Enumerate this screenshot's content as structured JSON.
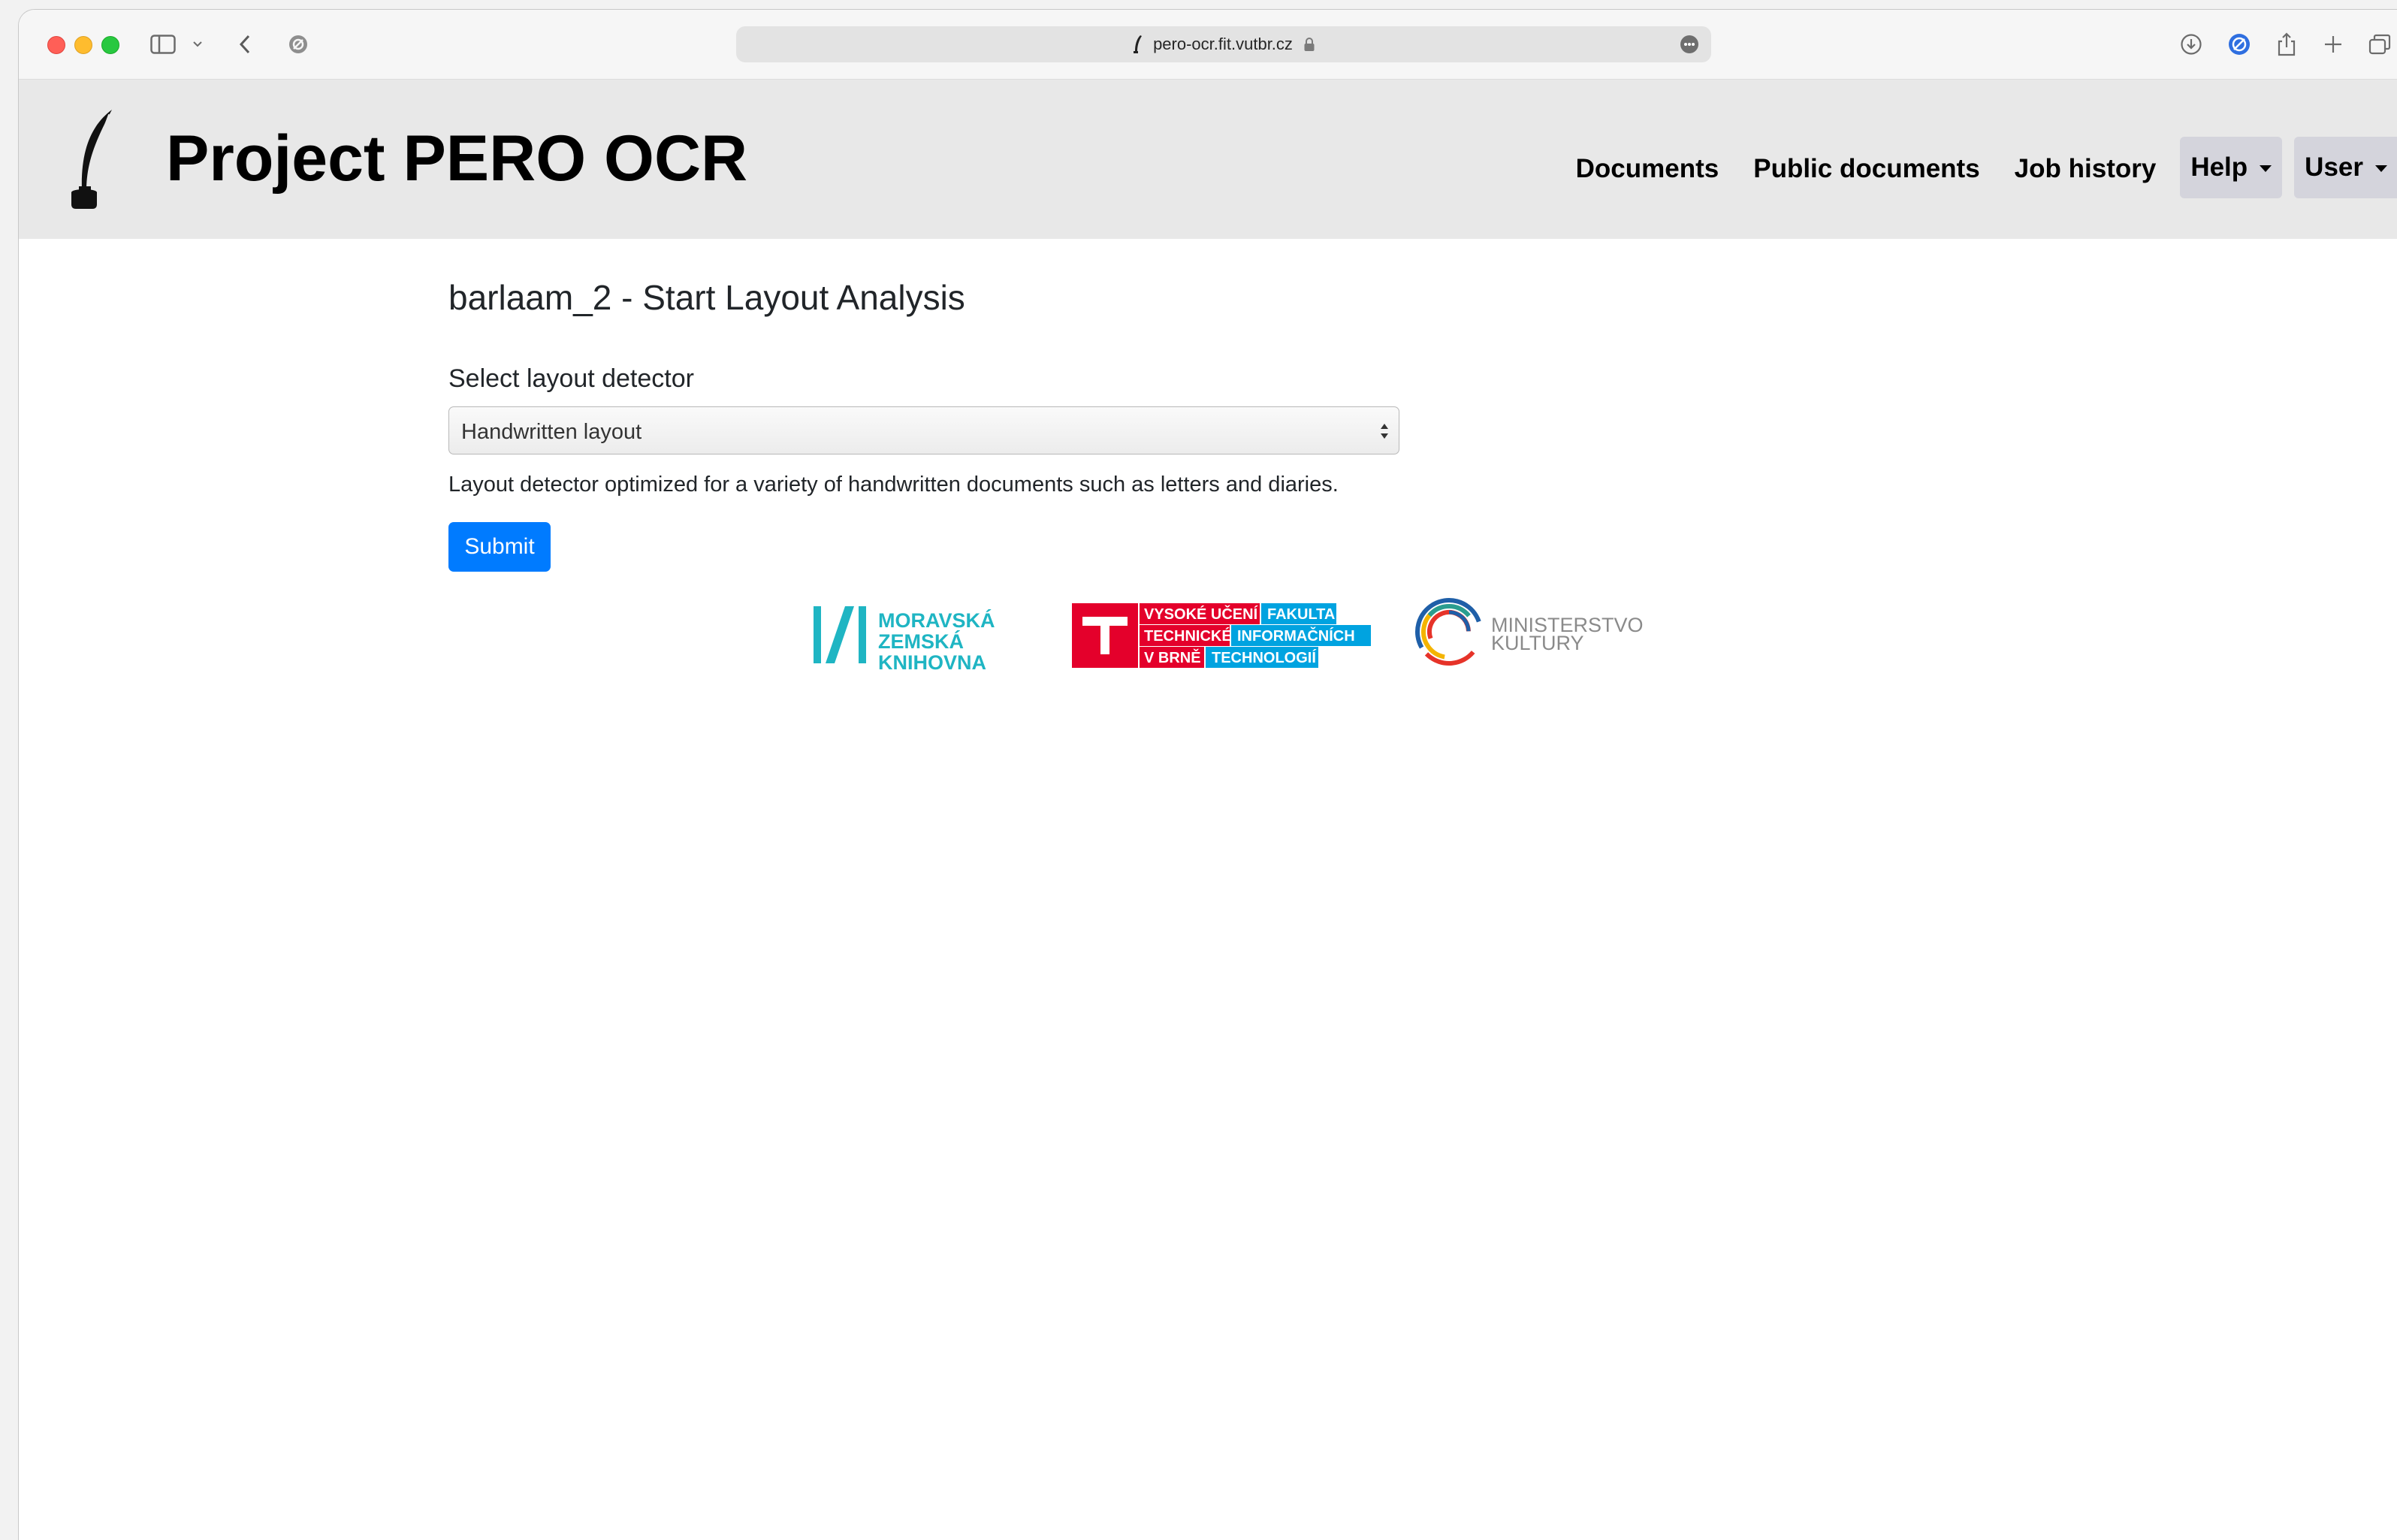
{
  "browser": {
    "url": "pero-ocr.fit.vutbr.cz"
  },
  "header": {
    "title": "Project PERO OCR",
    "nav": {
      "documents": "Documents",
      "public_documents": "Public documents",
      "job_history": "Job history",
      "help": "Help",
      "user": "User"
    }
  },
  "main": {
    "page_title": "barlaam_2 - Start Layout Analysis",
    "field_label": "Select layout detector",
    "select_value": "Handwritten layout",
    "help_text": "Layout detector optimized for a variety of handwritten documents such as letters and diaries.",
    "submit_label": "Submit"
  },
  "partners": {
    "mzk": [
      "MORAVSKÁ",
      "ZEMSKÁ",
      "KNIHOVNA"
    ],
    "vut": {
      "left": [
        "VYSOKÉ UČENÍ",
        "TECHNICKÉ",
        "V BRNĚ"
      ],
      "right": [
        "FAKULTA",
        "INFORMAČNÍCH",
        "TECHNOLOGIÍ"
      ]
    },
    "mk": [
      "MINISTERSTVO",
      "KULTURY"
    ]
  },
  "colors": {
    "primary": "#007bff",
    "header_bg": "#e8e8e8",
    "dropdown_bg": "#d4d4dc",
    "mzk_teal": "#1fb5c3",
    "vut_red": "#e4002b",
    "vut_blue": "#00a3e0"
  }
}
